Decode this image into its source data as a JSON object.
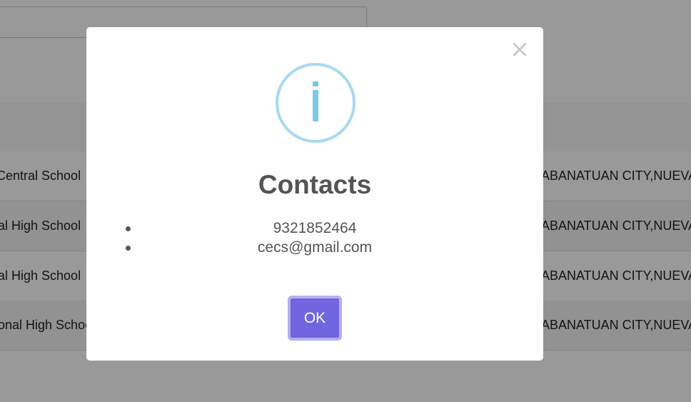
{
  "table": {
    "rows": [
      {
        "name": "Central School",
        "address": "ABANATUAN CITY,NUEVA"
      },
      {
        "name": "al High School",
        "address": "ABANATUAN CITY,NUEVA"
      },
      {
        "name": "al High School",
        "address": "ABANATUAN CITY,NUEVA"
      },
      {
        "name": "onal High School",
        "address": "ABANATUAN CITY,NUEVA"
      }
    ]
  },
  "modal": {
    "icon": "info-icon",
    "close_glyph": "×",
    "title": "Contacts",
    "contacts": [
      "9321852464",
      "cecs@gmail.com"
    ],
    "ok_label": "OK",
    "accent": "#7066e0",
    "icon_color": "#7ac7e8"
  }
}
